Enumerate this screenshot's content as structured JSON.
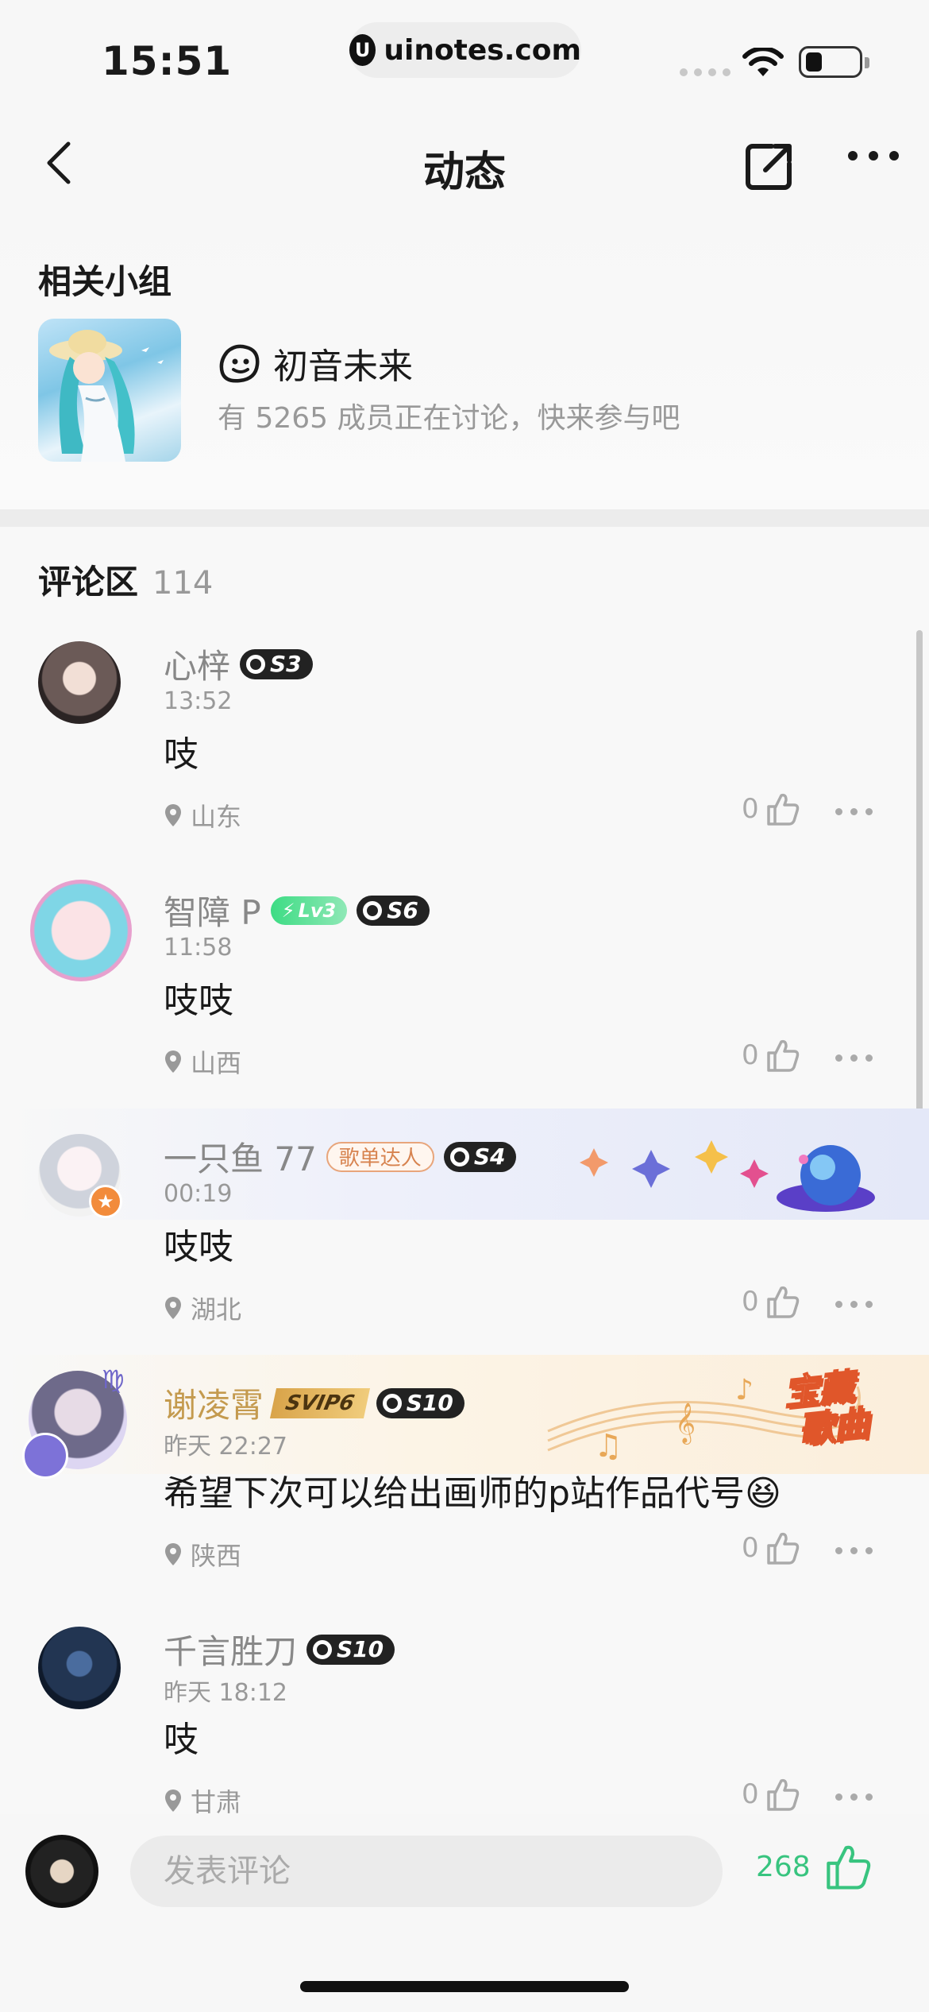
{
  "status_bar": {
    "time": "15:51",
    "url": "uinotes.com",
    "url_logo": "U",
    "icons": [
      "signal-icon",
      "wifi-icon",
      "battery-icon"
    ]
  },
  "nav": {
    "title": "动态",
    "icons": [
      "back-icon",
      "share-icon",
      "more-icon"
    ]
  },
  "group": {
    "section_title": "相关小组",
    "name": "初音未来",
    "description": "有 5265 成员正在讨论，快来参与吧",
    "icon": "group-chat-icon"
  },
  "comments": {
    "title": "评论区",
    "count": "114",
    "items": [
      {
        "user": "心梓",
        "badges": {
          "level": "S3"
        },
        "time": "13:52",
        "text": "吱",
        "location": "山东",
        "likes": "0"
      },
      {
        "user": "智障 P",
        "badges": {
          "lv": "Lv3",
          "level": "S6"
        },
        "time": "11:58",
        "text": "吱吱",
        "location": "山西",
        "likes": "0"
      },
      {
        "user": "一只鱼 77",
        "badges": {
          "playlist": "歌单达人",
          "level": "S4"
        },
        "time": "00:19",
        "text": "吱吱",
        "location": "湖北",
        "likes": "0"
      },
      {
        "user": "谢凌霄",
        "badges": {
          "svip": "SVIP6",
          "level": "S10"
        },
        "time": "昨天 22:27",
        "text": "希望下次可以给出画师的p站作品代号",
        "emoji": "😆",
        "location": "陕西",
        "likes": "0",
        "decoration": {
          "line1": "宝藏",
          "line2": "歌曲"
        }
      },
      {
        "user": "千言胜刀",
        "badges": {
          "level": "S10"
        },
        "time": "昨天 18:12",
        "text": "吱",
        "location": "甘肃",
        "likes": "0"
      }
    ]
  },
  "bottom_bar": {
    "input_placeholder": "发表评论",
    "like_count": "268"
  },
  "colors": {
    "accent_green": "#38c47f",
    "background": "#f7f7f7",
    "muted_text": "#999999",
    "gold_name": "#c49a4e"
  }
}
